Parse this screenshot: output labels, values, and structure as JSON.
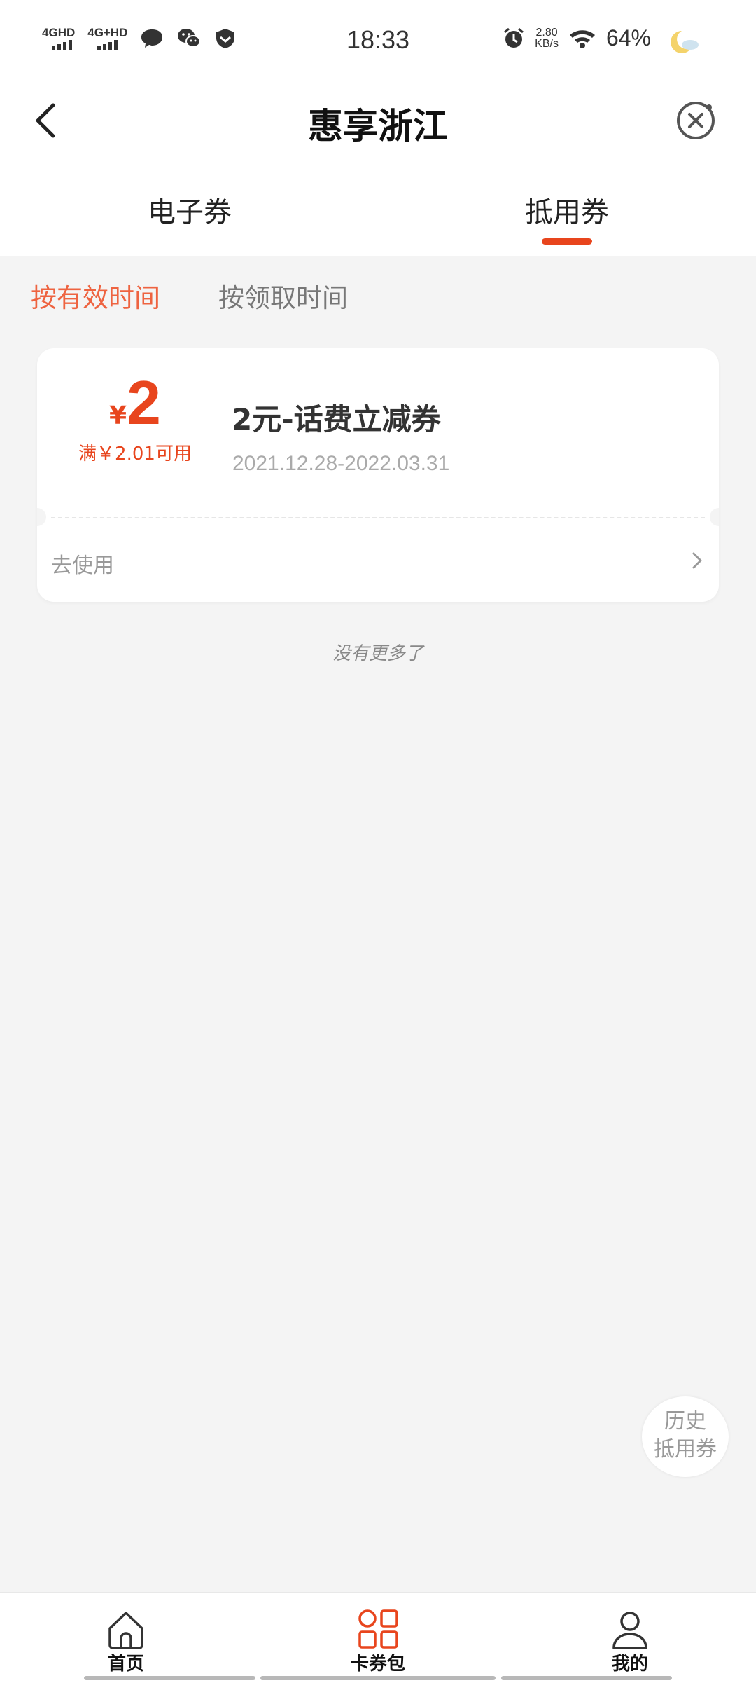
{
  "status_bar": {
    "signal1": "4G",
    "signal1_sup": "HD",
    "signal2": "4G+",
    "signal2_sup": "HD",
    "time": "18:33",
    "net_speed_value": "2.80",
    "net_speed_unit": "KB/s",
    "battery": "64%",
    "icons": [
      "message-icon",
      "wechat-icon",
      "shield-icon",
      "alarm-icon",
      "wifi-icon",
      "moon-weather-icon"
    ]
  },
  "header": {
    "title": "惠享浙江",
    "back_icon": "chevron-left-icon",
    "close_icon": "close-circle-icon"
  },
  "tabs": [
    {
      "label": "电子券",
      "active": false
    },
    {
      "label": "抵用券",
      "active": true
    }
  ],
  "sort": {
    "options": [
      "按有效时间",
      "按领取时间"
    ],
    "active_index": 0
  },
  "coupons": [
    {
      "currency": "¥",
      "amount": "2",
      "condition": "满￥2.01可用",
      "name": "2元-话费立减券",
      "validity": "2021.12.28-2022.03.31",
      "action": "去使用"
    }
  ],
  "list_end_text": "没有更多了",
  "history_button": {
    "line1": "历史",
    "line2": "抵用券"
  },
  "bottom_nav": [
    {
      "label": "首页",
      "icon": "home-icon",
      "active": false
    },
    {
      "label": "卡券包",
      "icon": "grid-icon",
      "active": true
    },
    {
      "label": "我的",
      "icon": "user-icon",
      "active": false
    }
  ],
  "colors": {
    "accent": "#e8451d",
    "sort_active": "#ee6340",
    "background": "#f4f4f4"
  }
}
